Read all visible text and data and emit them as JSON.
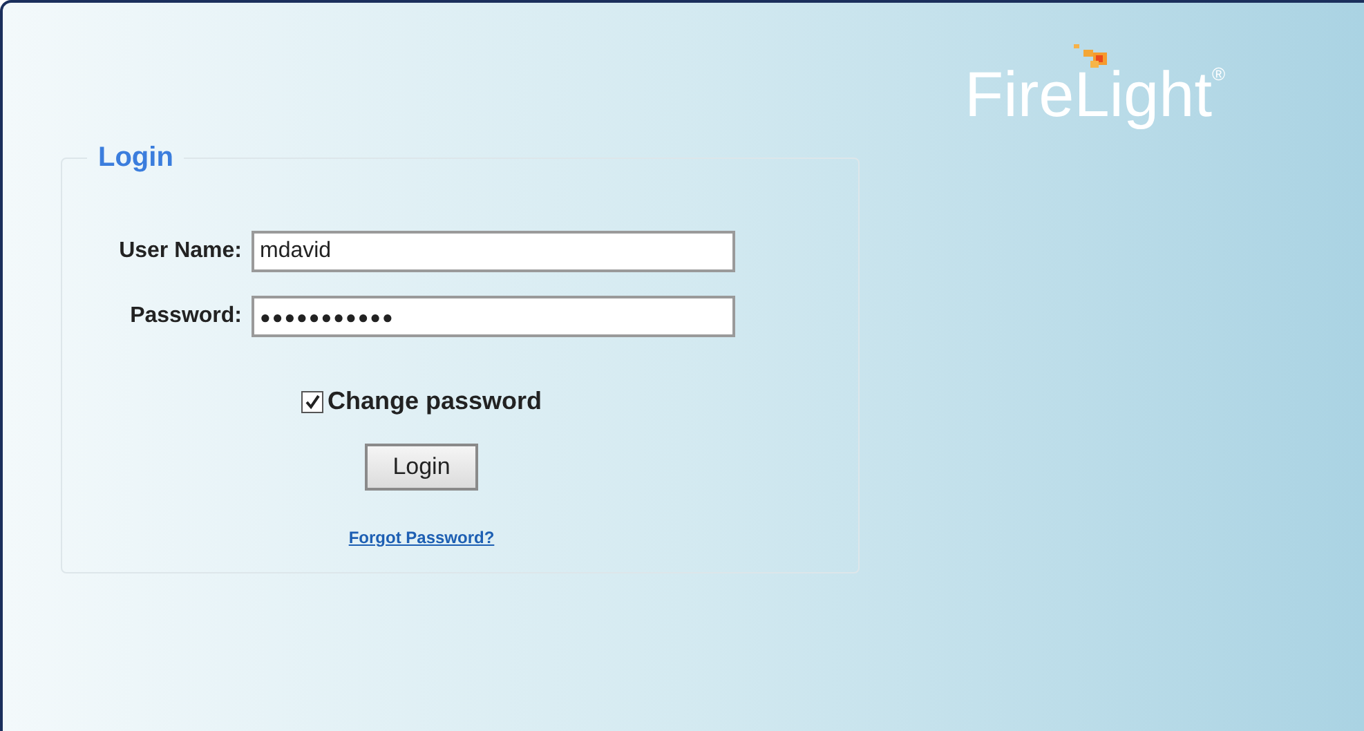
{
  "logo": {
    "name": "FireLight",
    "mark": "®"
  },
  "login": {
    "legend": "Login",
    "fields": [
      {
        "label": "User Name:",
        "value": "mdavid"
      },
      {
        "label": "Password:",
        "value": "●●●●●●●●●●●"
      }
    ],
    "change_password": {
      "label": "Change password",
      "checked": true
    },
    "button": "Login",
    "forgot_link": "Forgot Password?"
  }
}
